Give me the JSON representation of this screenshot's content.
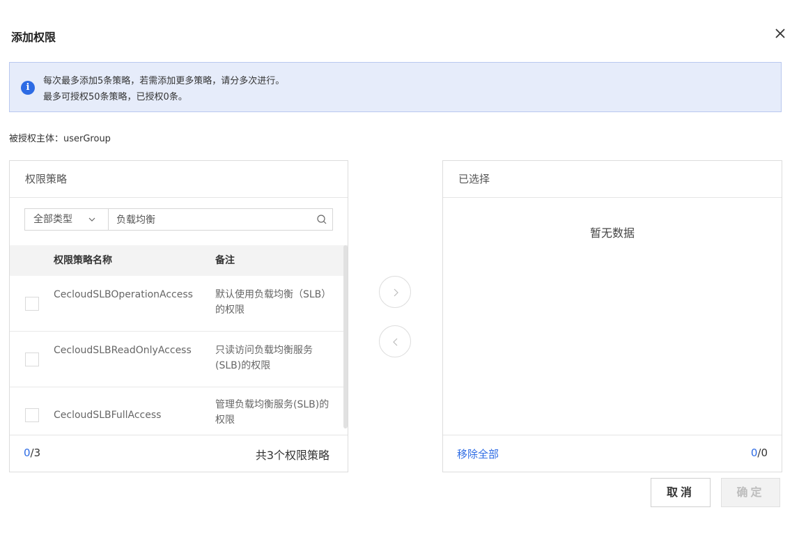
{
  "dialog": {
    "title": "添加权限"
  },
  "notice": {
    "line1": "每次最多添加5条策略，若需添加更多策略，请分多次进行。",
    "line2": "最多可授权50条策略，已授权0条。",
    "icon_glyph": "i",
    "icon_color": "#2d6be4",
    "background": "#e6ecfa"
  },
  "principal": {
    "text": "被授权主体：userGroup"
  },
  "left_panel": {
    "title": "权限策略",
    "type_select": "全部类型",
    "search_value": "负载均衡",
    "columns": {
      "name": "权限策略名称",
      "note": "备注"
    },
    "rows": [
      {
        "name": "CecloudSLBOperationAccess",
        "note": "默认使用负载均衡（SLB）的权限"
      },
      {
        "name": "CecloudSLBReadOnlyAccess",
        "note": "只读访问负载均衡服务(SLB)的权限"
      },
      {
        "name": "CecloudSLBFullAccess",
        "note": "管理负载均衡服务(SLB)的权限"
      }
    ],
    "footer": {
      "selected": "0",
      "total_sep": "/3",
      "summary": "共3个权限策略"
    }
  },
  "right_panel": {
    "title": "已选择",
    "empty_text": "暂无数据",
    "remove_all": "移除全部",
    "footer": {
      "selected": "0",
      "total_sep": "/0"
    }
  },
  "buttons": {
    "cancel": "取消",
    "ok": "确定"
  },
  "colors": {
    "accent": "#2d6be4"
  }
}
